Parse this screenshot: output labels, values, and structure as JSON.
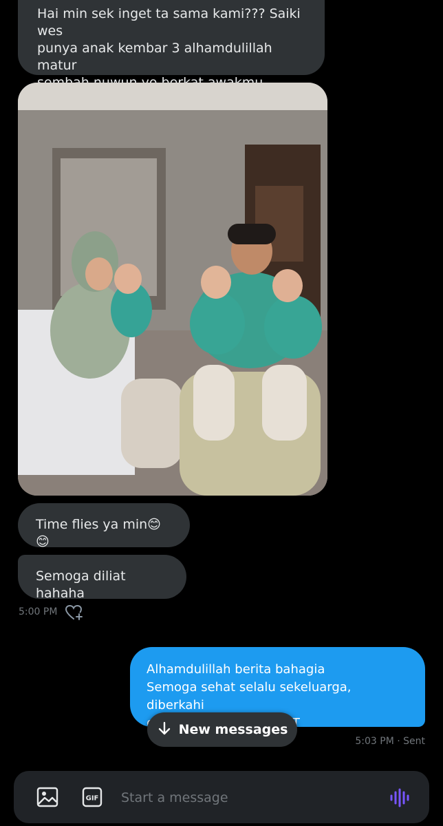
{
  "messages": {
    "received_1": {
      "lines": [
        "Hai min sek inget ta sama kami??? Saiki wes",
        "punya anak kembar 3 alhamdulillah matur",
        "sembah nuwun yo berkat awakmu"
      ]
    },
    "received_2": {
      "text": "Time flies ya min😊😊"
    },
    "received_3": {
      "text": "Semoga diliat hahaha"
    },
    "received_time": "5:00 PM",
    "sent_1": {
      "lines": [
        "Alhamdulillah berita bahagia",
        "Semoga sehat selalu sekeluarga, diberkahi",
        "dan dirahmati Allah SWT"
      ]
    },
    "sent_status": "5:03 PM · Sent"
  },
  "new_messages": {
    "label": "New messages",
    "icon": "arrow-down-icon"
  },
  "composer": {
    "placeholder": "Start a message",
    "gif_label": "GIF",
    "icons": [
      "image-icon",
      "gif-icon",
      "voice-icon"
    ]
  },
  "colors": {
    "background": "#000000",
    "received_bubble": "#2f3336",
    "sent_bubble": "#1d9bf0",
    "voice_accent": "#7856ff",
    "secondary_text": "#71767b"
  }
}
